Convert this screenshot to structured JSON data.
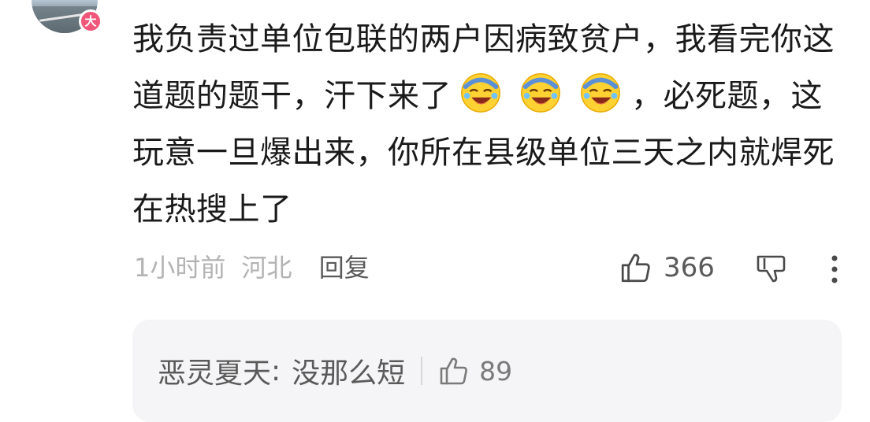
{
  "user": {
    "badge_label": "大"
  },
  "comment": {
    "text_part1": "我负责过单位包联的两户因病致贫户，我看完你这道题的题干，汗下来了",
    "text_part2": "，必死题，这玩意一旦爆出来，你所在县级单位三天之内就焊死在热搜上了",
    "emoji_icons": [
      "laughing-crying-emoji",
      "laughing-crying-emoji",
      "laughing-crying-emoji"
    ],
    "time": "1小时前",
    "location": "河北",
    "reply_label": "回复",
    "like_count": "366"
  },
  "reply_preview": {
    "author": "恶灵夏天",
    "separator": ":",
    "text": "没那么短",
    "like_count": "89"
  },
  "colors": {
    "badge": "#f0567a",
    "text_primary": "#1a1a1a",
    "text_secondary": "#b3b3b3",
    "reply_bg": "#f5f5f7",
    "emoji_face": "#ffd233"
  }
}
